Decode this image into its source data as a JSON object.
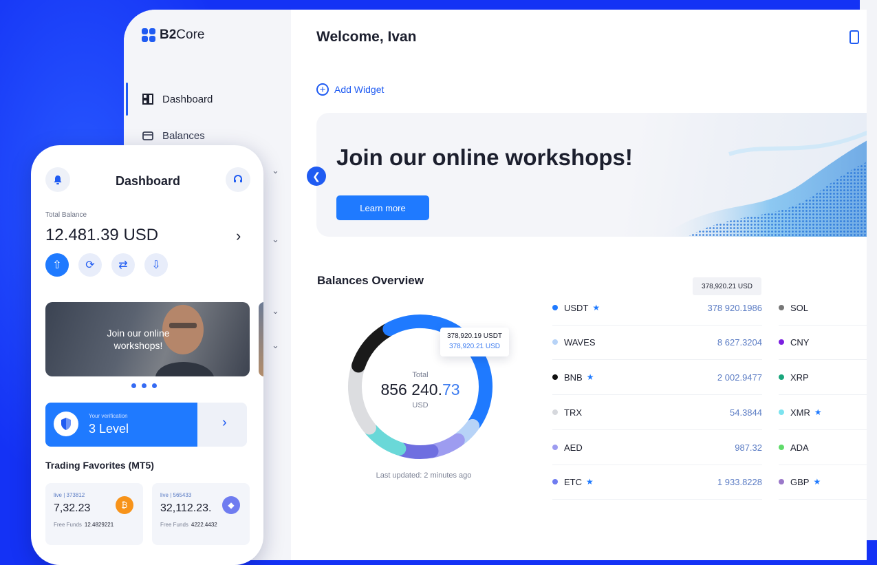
{
  "app": {
    "brand_strong": "B2",
    "brand_light": "Core"
  },
  "sidebar": {
    "items": [
      {
        "label": "Dashboard",
        "icon": "dashboard-icon",
        "active": true
      },
      {
        "label": "Balances",
        "icon": "wallet-icon",
        "active": false
      }
    ]
  },
  "header": {
    "welcome": "Welcome, Ivan"
  },
  "add_widget": {
    "label": "Add Widget"
  },
  "banner": {
    "title": "Join our online workshops!",
    "button": "Learn more"
  },
  "balances": {
    "title": "Balances Overview",
    "total_label": "Total",
    "total_int": "856 240.",
    "total_frac": "73",
    "total_currency": "USD",
    "last_updated": "Last updated: 2 minutes ago",
    "donut_tooltip_l1": "378,920.19 USDT",
    "donut_tooltip_l2": "378,920.21 USD",
    "row_tooltip": "378,920.21 USD",
    "rows": [
      {
        "symbol": "USDT",
        "star": true,
        "amount": "378 920.1986",
        "color": "#1f7aff"
      },
      {
        "symbol": "WAVES",
        "star": false,
        "amount": "8 627.3204",
        "color": "#b7d3f7"
      },
      {
        "symbol": "BNB",
        "star": true,
        "amount": "2 002.9477",
        "color": "#111111"
      },
      {
        "symbol": "TRX",
        "star": false,
        "amount": "54.3844",
        "color": "#d6d8dd"
      },
      {
        "symbol": "AED",
        "star": false,
        "amount": "987.32",
        "color": "#9d9cf0"
      },
      {
        "symbol": "ETC",
        "star": true,
        "amount": "1 933.8228",
        "color": "#6f7cf0"
      }
    ],
    "rows2": [
      {
        "symbol": "SOL",
        "star": false,
        "color": "#777777"
      },
      {
        "symbol": "CNY",
        "star": false,
        "color": "#7b1fe0"
      },
      {
        "symbol": "XRP",
        "star": false,
        "color": "#19a67c"
      },
      {
        "symbol": "XMR",
        "star": true,
        "color": "#7ce3ef"
      },
      {
        "symbol": "ADA",
        "star": false,
        "color": "#5fdb6a"
      },
      {
        "symbol": "GBP",
        "star": true,
        "color": "#9a78c9"
      }
    ],
    "donut_segments": [
      {
        "asset": "USDT",
        "share": 0.32,
        "color": "#1f7aff"
      },
      {
        "asset": "WAVES",
        "share": 0.05,
        "color": "#b7d3f7"
      },
      {
        "asset": "ETC",
        "share": 0.07,
        "color": "#9d9cf0"
      },
      {
        "asset": "AED",
        "share": 0.08,
        "color": "#6f6fe0"
      },
      {
        "asset": "XMR",
        "share": 0.09,
        "color": "#6ad8d8"
      },
      {
        "asset": "TRX",
        "share": 0.16,
        "color": "#dcdde0"
      },
      {
        "asset": "BNB",
        "share": 0.12,
        "color": "#1a1a1a"
      },
      {
        "asset": "USDT-2",
        "share": 0.11,
        "color": "#1f7aff"
      }
    ]
  },
  "phone": {
    "title": "Dashboard",
    "total_label": "Total Balance",
    "total": "12.481.39 USD",
    "card_text_1": "Join our online",
    "card_text_2": "workshops!",
    "verification_label": "Your verification",
    "verification_level": "3 Level",
    "trading_title": "Trading Favorites (MT5)",
    "favorites": [
      {
        "account": "live | 373812",
        "value": "7,32.23",
        "free_label": "Free Funds",
        "free_value": "12.4829221",
        "coin": "bitcoin-icon",
        "coin_color": "#f7931a",
        "coin_glyph": "₿"
      },
      {
        "account": "live | 565433",
        "value": "32,112.23.",
        "free_label": "Free Funds",
        "free_value": "4222.4432",
        "coin": "ethereum-icon",
        "coin_color": "#6f7cf0",
        "coin_glyph": "◆"
      }
    ]
  }
}
